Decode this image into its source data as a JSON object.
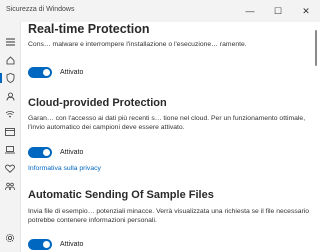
{
  "window": {
    "title": "Sicurezza di Windows",
    "minimize": "—",
    "maximize": "☐",
    "close": "✕"
  },
  "sections": [
    {
      "heading": "Real-time Protection",
      "description": "Cons… malware e interrompere l'installazione o l'esecuzione… ramente.",
      "toggle_label": "Attivato"
    },
    {
      "heading": "Cloud-provided Protection",
      "description": "Garan… con l'accesso ai dati più recenti s… tione nel cloud. Per un funzionamento ottimale, l'invio automatico dei campioni deve essere attivato.",
      "toggle_label": "Attivato",
      "link": "Informativa sulla privacy"
    },
    {
      "heading": "Automatic Sending Of Sample Files",
      "description": "Invia file di esempio… potenziali minacce. Verrà visualizzata una richiesta se il file necessario potrebbe contenere informazioni personali.",
      "toggle_label": "Attivato"
    }
  ],
  "sidebar_icons": [
    "menu-icon",
    "home-icon",
    "shield-icon",
    "person-icon",
    "wifi-icon",
    "browser-icon",
    "laptop-icon",
    "heart-icon",
    "family-icon",
    "settings-icon"
  ]
}
